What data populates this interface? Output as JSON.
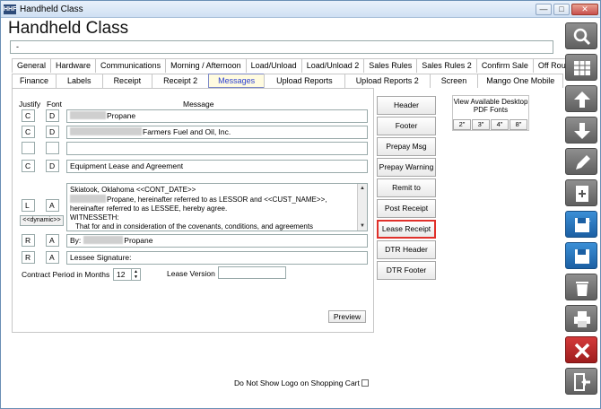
{
  "window": {
    "title": "Handheld Class",
    "app_icon_text": "HHF",
    "controls": {
      "minimize": "—",
      "maximize": "□",
      "close": "✕"
    }
  },
  "header": {
    "app_title": "Handheld Class",
    "top_field_value": "-"
  },
  "tabs_row1": [
    "General",
    "Hardware",
    "Communications",
    "Morning / Afternoon",
    "Load/Unload",
    "Load/Unload 2",
    "Sales Rules",
    "Sales Rules 2",
    "Confirm Sale",
    "Off Route"
  ],
  "tabs_row2": [
    "Finance",
    "Labels",
    "Receipt",
    "Receipt 2",
    "Messages",
    "Upload Reports",
    "Upload Reports 2",
    "Screen",
    "Mango One Mobile"
  ],
  "active_tab": "Messages",
  "columns": {
    "justify": "Justify",
    "font": "Font",
    "message": "Message"
  },
  "rows": [
    {
      "justify": "C",
      "font": "D",
      "message": "Propane"
    },
    {
      "justify": "C",
      "font": "D",
      "message": "Farmers Fuel and Oil, Inc."
    },
    {
      "justify": "",
      "font": "",
      "message": ""
    },
    {
      "justify": "C",
      "font": "D",
      "message": "Equipment Lease and Agreement"
    }
  ],
  "lease_block": {
    "justify": "L",
    "font": "A",
    "dynamic_button": "<<dynamic>>",
    "lines": [
      "Skiatook, Oklahoma  <<CONT_DATE>>",
      "Propane, hereinafter referred to as LESSOR and  <<CUST_NAME>>,",
      "hereinafter referred to as LESSEE, hereby agree.",
      "WITNESSETH:",
      "That for and in consideration of the covenants, conditions, and agreements"
    ]
  },
  "signature_rows": [
    {
      "justify": "R",
      "font": "A",
      "message_prefix": "By:",
      "message_suffix": "Propane"
    },
    {
      "justify": "R",
      "font": "A",
      "message_prefix": "Lessee Signature:",
      "message_suffix": ""
    }
  ],
  "contract": {
    "label": "Contract Period in Months",
    "value": "12",
    "version_label": "Lease Version",
    "version_value": ""
  },
  "preview_button": "Preview",
  "side_buttons": [
    "Header",
    "Footer",
    "Prepay Msg",
    "Prepay Warning",
    "Remit to",
    "Post Receipt",
    "Lease Receipt",
    "DTR Header",
    "DTR Footer"
  ],
  "highlighted_side_button": "Lease Receipt",
  "pdf_fonts": {
    "title": "View Available Desktop PDF Fonts",
    "sizes": [
      "2\"",
      "3\"",
      "4\"",
      "8\""
    ]
  },
  "logo_checkbox_label": "Do Not Show Logo on Shopping Cart",
  "toolbar_icons": [
    "search-icon",
    "grid-icon",
    "arrow-up-icon",
    "arrow-down-icon",
    "pencil-icon",
    "add-document-icon",
    "save-new-icon",
    "save-icon",
    "trash-icon",
    "print-icon",
    "close-icon",
    "exit-icon"
  ]
}
